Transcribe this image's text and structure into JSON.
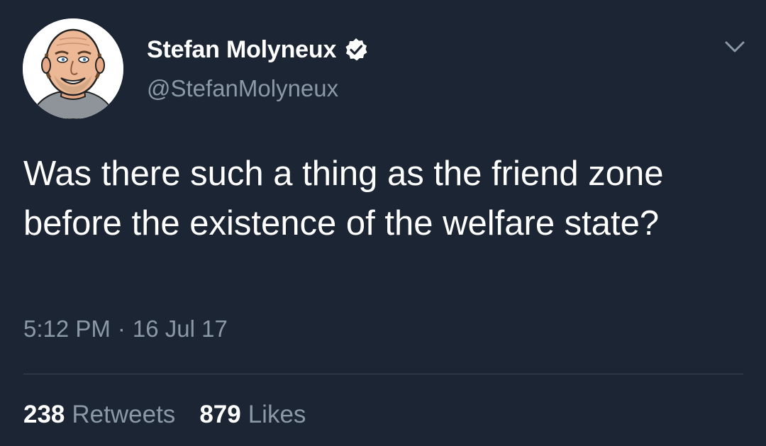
{
  "author": {
    "display_name": "Stefan Molyneux",
    "handle": "@StefanMolyneux",
    "verified_icon": "verified-badge-icon"
  },
  "tweet": {
    "text": "Was there such a thing as the friend zone before the existence of the welfare state?",
    "time": "5:12 PM",
    "separator": "·",
    "date": "16 Jul 17"
  },
  "stats": {
    "retweets_count": "238",
    "retweets_label": "Retweets",
    "likes_count": "879",
    "likes_label": "Likes"
  },
  "colors": {
    "background": "#1c2533",
    "primary_text": "#ffffff",
    "secondary_text": "#8b98a6",
    "divider": "#3a4554"
  }
}
